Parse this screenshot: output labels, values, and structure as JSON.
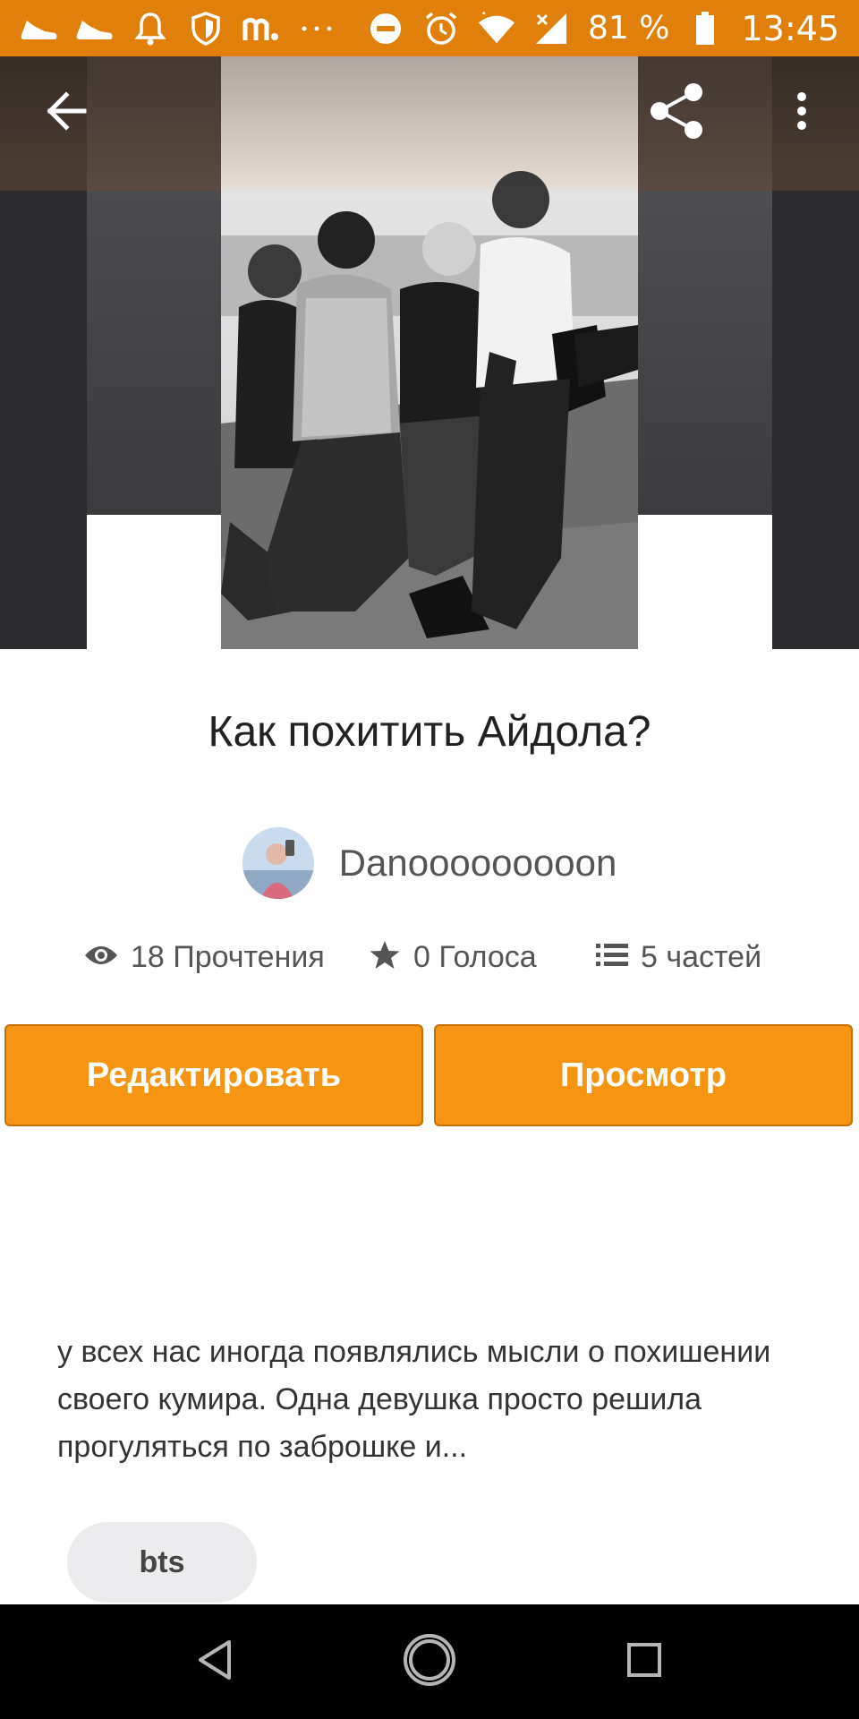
{
  "status_bar": {
    "battery_text": "81 %",
    "time": "13:45",
    "icons": [
      "shoe-icon",
      "shoe-icon",
      "bell-icon",
      "shield-icon",
      "m-app-icon",
      "more-dots-icon",
      "do-not-disturb-icon",
      "alarm-icon",
      "wifi-icon",
      "signal-icon",
      "battery-icon"
    ]
  },
  "toolbar": {
    "back_icon": "back-arrow-icon",
    "share_icon": "share-icon",
    "menu_icon": "more-vertical-icon"
  },
  "story": {
    "title": "Как похитить Айдола?",
    "author": "Danooooooooon",
    "stats": {
      "reads": "18 Прочтения",
      "votes": "0 Голоса",
      "parts": "5 частей"
    },
    "description": "у всех нас иногда появлялись мысли о похишении своего кумира.  Одна девушка просто решила прогуляться по заброшке и...",
    "tags": [
      "bts"
    ]
  },
  "actions": {
    "edit_label": "Редактировать",
    "view_label": "Просмотр"
  },
  "colors": {
    "status_bar": "#e0800a",
    "accent": "#f59512",
    "nav_bar": "#000000"
  },
  "nav_bar": {
    "icons": [
      "back-triangle-icon",
      "home-circle-icon",
      "recents-square-icon"
    ]
  }
}
